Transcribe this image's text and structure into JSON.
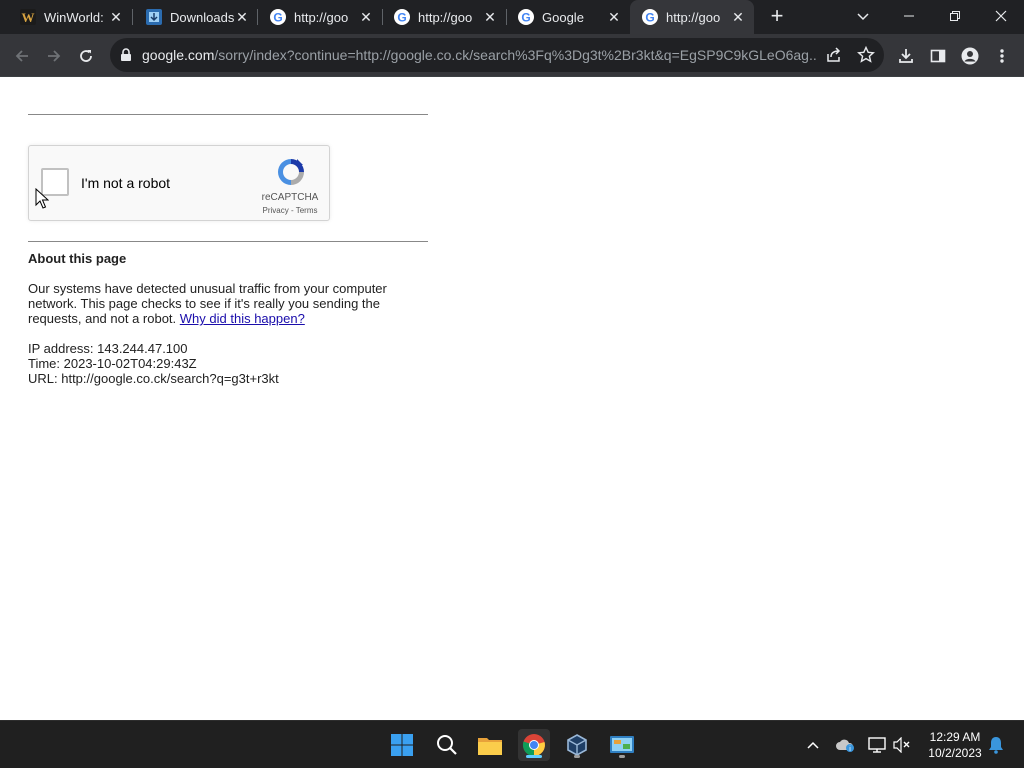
{
  "browser": {
    "tabs": [
      {
        "title": "WinWorld: ",
        "icon": "winworld-icon",
        "active": false
      },
      {
        "title": "Downloads",
        "icon": "downloads-site-icon",
        "active": false
      },
      {
        "title": "http://goo",
        "icon": "google-g-icon",
        "active": false
      },
      {
        "title": "http://goo",
        "icon": "google-g-icon",
        "active": false
      },
      {
        "title": "Google",
        "icon": "google-g-icon",
        "active": false
      },
      {
        "title": "http://goo",
        "icon": "google-g-icon",
        "active": true
      }
    ],
    "url_host": "google.com",
    "url_rest": "/sorry/index?continue=http://google.co.ck/search%3Fq%3Dg3t%2Br3kt&q=EgSP9C9kGLeO6ag..."
  },
  "page": {
    "captcha": {
      "label": "I'm not a robot",
      "brand": "reCAPTCHA",
      "privacy": "Privacy",
      "separator": " - ",
      "terms": "Terms"
    },
    "about_title": "About this page",
    "about_text": "Our systems have detected unusual traffic from your computer network. This page checks to see if it's really you sending the requests, and not a robot. ",
    "about_link": "Why did this happen?",
    "ip_line": "IP address: 143.244.47.100",
    "time_line": "Time: 2023-10-02T04:29:43Z",
    "url_line": "URL: http://google.co.ck/search?q=g3t+r3kt"
  },
  "taskbar": {
    "time": "12:29 AM",
    "date": "10/2/2023"
  },
  "colors": {
    "link": "#1a0dab",
    "tabstrip": "#202124",
    "toolbar": "#35363a",
    "taskbar": "#202020",
    "recaptcha_blue": "#4a90e2"
  }
}
